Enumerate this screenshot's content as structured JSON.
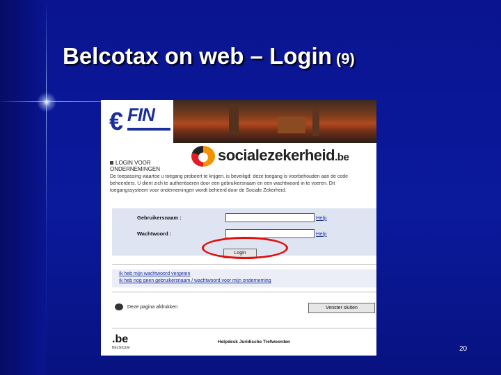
{
  "slide": {
    "title": "Belcotax on web – Login",
    "title_suffix": "(9)",
    "number": "20"
  },
  "screenshot": {
    "login_heading_line1": "LOGIN VOOR",
    "login_heading_line2": "ONDERNEMINGEN",
    "intro_text": "De toepassing waartoe u toegang probeert te krijgen, is beveiligd: deze toegang is voorbehouden aan de code beheerders. U dient zich te authentiseren door een gebruikersnaam en een wachtwoord in te voeren. Dit toegangssysteem voor ondernemingen wordt beheerd door de Sociale Zekerheid.",
    "username_label": "Gebruikersnaam :",
    "password_label": "Wachtwoord :",
    "help_label": "Help",
    "login_button": "Login",
    "links": [
      "Ik heb mijn wachtwoord vergeten",
      "Ik heb nog geen gebruikersnaam / wachtwoord voor mijn onderneming"
    ],
    "print_label": "Deze pagina afdrukken",
    "close_button": "Venster sluiten",
    "be_logo": ".be",
    "be_logo_sub": "BELGIQUE",
    "footer": "Helpdesk   Juridische   Trefwoorden",
    "sz_logo_word": "socialezekerheid",
    "sz_logo_suffix": ".be",
    "fin_logo_euro": "€",
    "fin_logo_text": "FIN"
  },
  "colors": {
    "slide_bg": "#0a1490",
    "highlight_oval": "#e01010",
    "link_blue": "#1b2f9c"
  }
}
